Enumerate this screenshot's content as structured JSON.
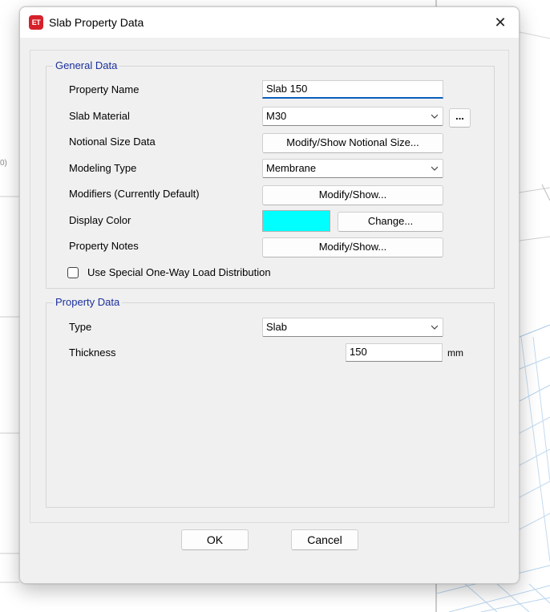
{
  "dialog": {
    "app_icon": "ET",
    "title": "Slab Property Data",
    "close_glyph": "✕"
  },
  "general": {
    "legend": "General Data",
    "property_name_label": "Property Name",
    "property_name_value": "Slab 150",
    "slab_material_label": "Slab Material",
    "slab_material_value": "M30",
    "material_more_label": "...",
    "notional_size_label": "Notional Size Data",
    "notional_size_button": "Modify/Show Notional Size...",
    "modeling_type_label": "Modeling Type",
    "modeling_type_value": "Membrane",
    "modifiers_label": "Modifiers (Currently Default)",
    "modifiers_button": "Modify/Show...",
    "display_color_label": "Display Color",
    "display_color_value": "#00ffff",
    "change_button": "Change...",
    "property_notes_label": "Property Notes",
    "property_notes_button": "Modify/Show...",
    "one_way_label": "Use Special One-Way Load Distribution",
    "one_way_checked": false
  },
  "property": {
    "legend": "Property Data",
    "type_label": "Type",
    "type_value": "Slab",
    "thickness_label": "Thickness",
    "thickness_value": "150",
    "thickness_unit": "mm"
  },
  "footer": {
    "ok_label": "OK",
    "cancel_label": "Cancel"
  },
  "background": {
    "edge_label": "0)"
  }
}
